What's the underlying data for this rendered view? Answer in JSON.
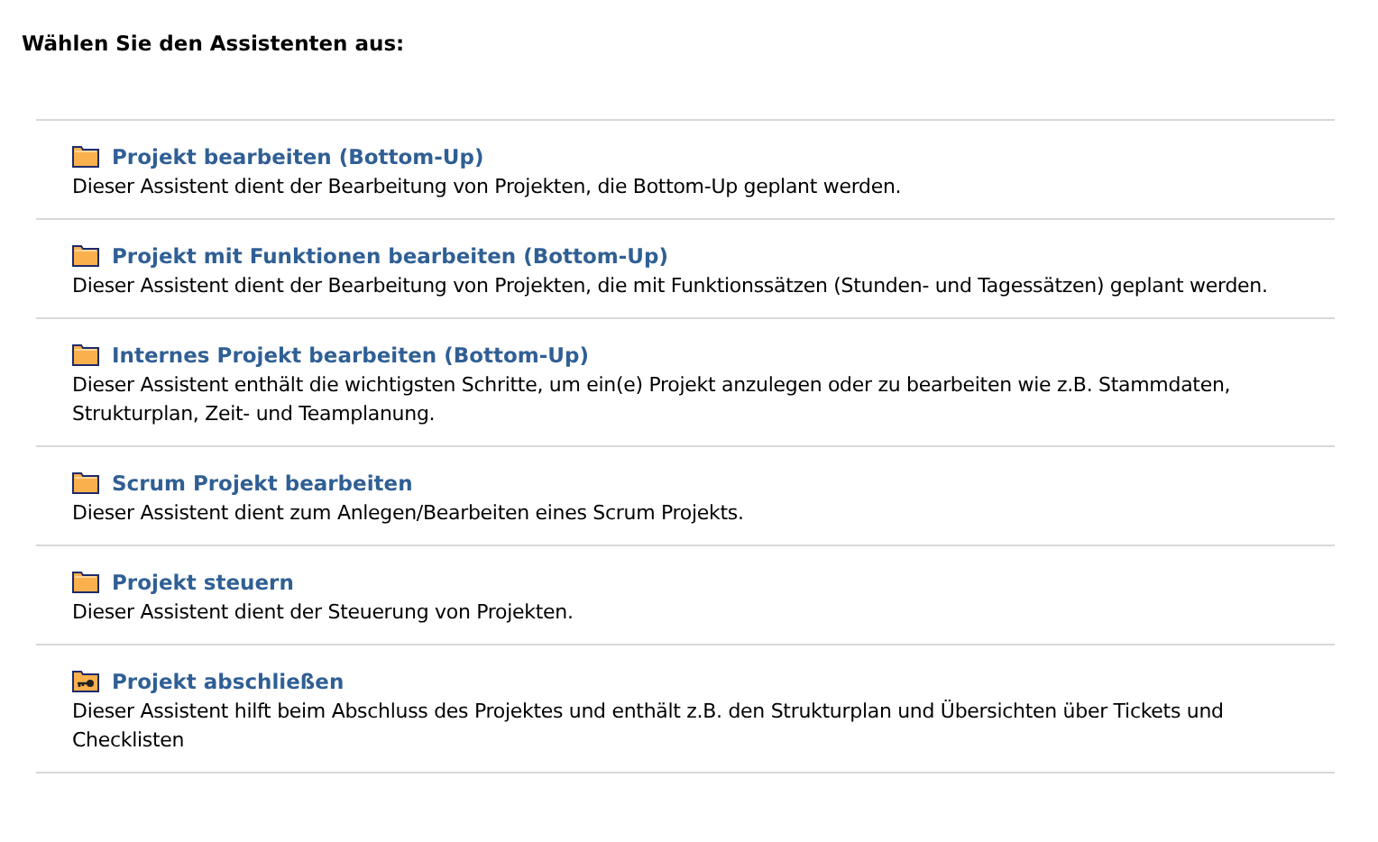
{
  "heading": "Wählen Sie den Assistenten aus:",
  "assistants": [
    {
      "kind": "folder",
      "title": "Projekt bearbeiten (Bottom-Up)",
      "description": "Dieser Assistent dient der Bearbeitung von Projekten, die Bottom-Up geplant werden."
    },
    {
      "kind": "folder",
      "title": "Projekt mit Funktionen bearbeiten (Bottom-Up)",
      "description": "Dieser Assistent dient der Bearbeitung von Projekten, die mit Funktionssätzen (Stunden- und Tagessätzen) geplant werden."
    },
    {
      "kind": "folder",
      "title": "Internes Projekt bearbeiten (Bottom-Up)",
      "description": "Dieser Assistent enthält die wichtigsten Schritte, um ein(e) Projekt anzulegen oder zu bearbeiten wie z.B. Stammdaten, Strukturplan, Zeit- und Teamplanung."
    },
    {
      "kind": "folder",
      "title": "Scrum Projekt bearbeiten",
      "description": "Dieser Assistent dient zum Anlegen/Bearbeiten eines Scrum Projekts."
    },
    {
      "kind": "folder",
      "title": "Projekt steuern",
      "description": "Dieser Assistent dient der Steuerung von Projekten."
    },
    {
      "kind": "folder-key",
      "title": "Projekt abschließen",
      "description": "Dieser Assistent hilft beim Abschluss des Projektes und enthält z.B. den Strukturplan und Übersichten über Tickets und Checklisten"
    }
  ]
}
